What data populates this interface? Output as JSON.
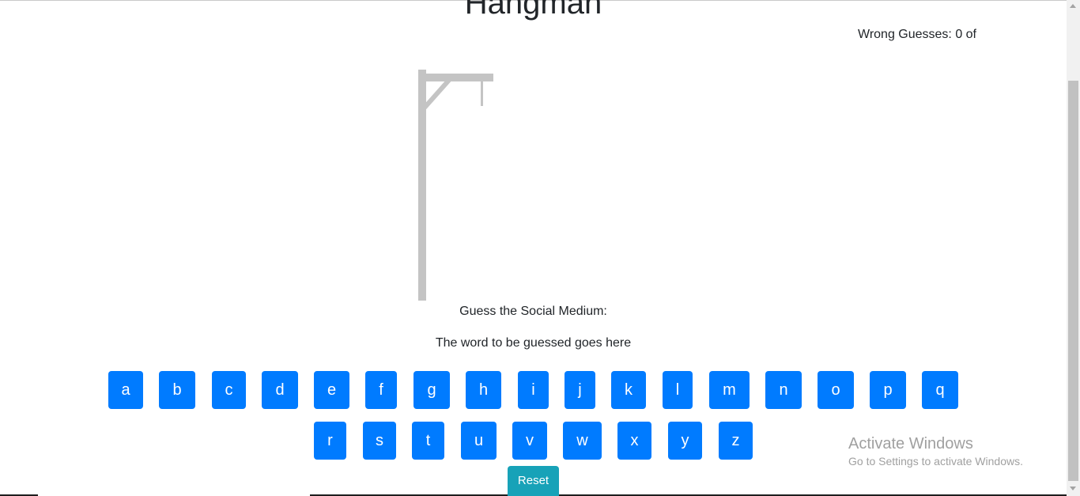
{
  "header": {
    "title": "Hangman",
    "wrong_guesses": "Wrong Guesses: 0 of"
  },
  "game": {
    "category": "Guess the Social Medium:",
    "word_placeholder": "The word to be guessed goes here",
    "wrong_count": 0
  },
  "keyboard": {
    "row1": [
      "a",
      "b",
      "c",
      "d",
      "e",
      "f",
      "g",
      "h",
      "i",
      "j",
      "k",
      "l",
      "m",
      "n",
      "o",
      "p",
      "q"
    ],
    "row2": [
      "r",
      "s",
      "t",
      "u",
      "v",
      "w",
      "x",
      "y",
      "z"
    ]
  },
  "reset_label": "Reset",
  "watermark": {
    "title": "Activate Windows",
    "subtitle": "Go to Settings to activate Windows."
  },
  "colors": {
    "key_bg": "#007bff",
    "reset_bg": "#17a2b8",
    "gallows": "#c4c4c4"
  },
  "icons": {
    "gallows": "gallows-drawing"
  }
}
